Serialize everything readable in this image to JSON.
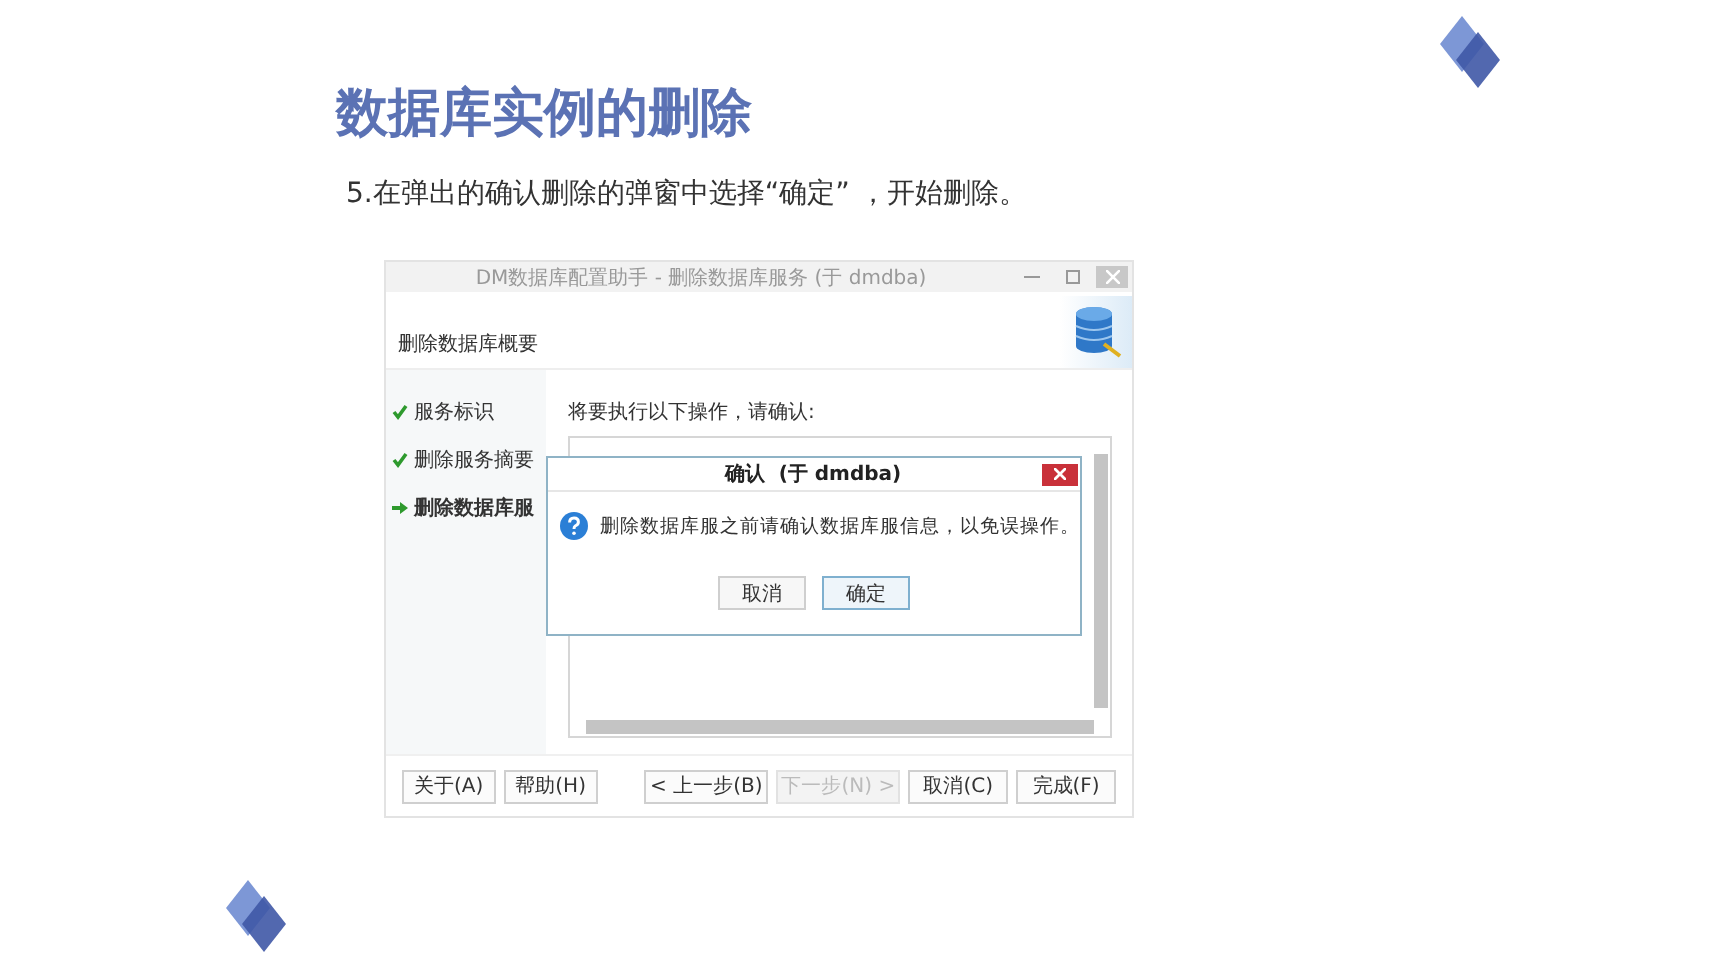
{
  "heading": "数据库实例的删除",
  "instruction": "5.在弹出的确认删除的弹窗中选择“确定” ，开始删除。",
  "window": {
    "title": "DM数据库配置助手 - 删除数据库服务 (于 dmdba)",
    "page_title": "删除数据库概要",
    "steps": [
      {
        "label": "服务标识",
        "kind": "done"
      },
      {
        "label": "删除服务摘要",
        "kind": "done"
      },
      {
        "label": "删除数据库服",
        "kind": "current"
      }
    ],
    "prompt": "将要执行以下操作，请确认:",
    "left_buttons": [
      {
        "label": "关于(A)",
        "disabled": false
      },
      {
        "label": "帮助(H)",
        "disabled": false
      }
    ],
    "nav_buttons": [
      {
        "label": "< 上一步(B)",
        "disabled": false
      },
      {
        "label": "下一步(N) >",
        "disabled": true
      },
      {
        "label": "取消(C)",
        "disabled": false
      },
      {
        "label": "完成(F)",
        "disabled": false
      }
    ]
  },
  "dialog": {
    "title": "确认  (于 dmdba)",
    "message": "删除数据库服之前请确认数据库服信息，以免误操作。",
    "buttons": [
      {
        "label": "取消",
        "default": false
      },
      {
        "label": "确定",
        "default": true
      }
    ]
  }
}
